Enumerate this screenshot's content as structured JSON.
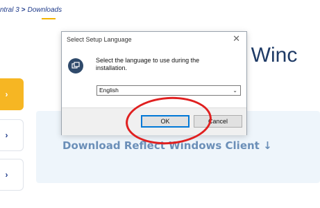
{
  "breadcrumb": {
    "parent": "ntral 3",
    "separator": ">",
    "current": "Downloads"
  },
  "heading_fragment": "ct Winc",
  "download_link": "Download Reflect Windows Client ↓",
  "side_buttons": [
    "›",
    "›",
    "›"
  ],
  "dialog": {
    "title": "Select Setup Language",
    "close": "✕",
    "prompt": "Select the language to use during the installation.",
    "language_value": "English",
    "ok_label": "OK",
    "cancel_label": "Cancel"
  },
  "icons": {
    "dropdown": "chevron-down-icon",
    "setup": "setup-icon",
    "close": "close-icon",
    "side": "chevron-right-icon"
  },
  "colors": {
    "accent": "#f6b623",
    "annotation": "#e02020",
    "heading": "#1f3b66",
    "link": "#6b8fb8"
  }
}
